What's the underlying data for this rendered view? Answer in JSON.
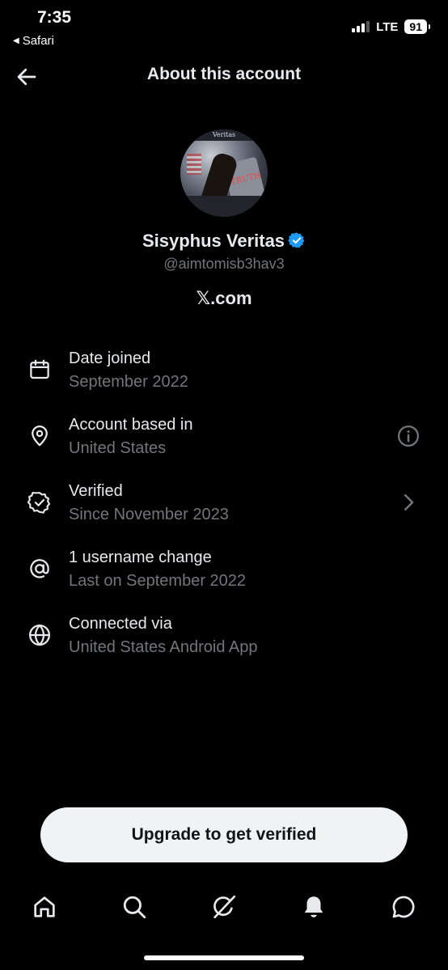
{
  "status_bar": {
    "time": "7:35",
    "back_app": "Safari",
    "network": "LTE",
    "battery": "91"
  },
  "header": {
    "title": "About this account",
    "back_icon": "arrow-left-icon"
  },
  "profile": {
    "display_name": "Sisyphus Veritas",
    "verified_badge": "verified-badge-icon",
    "handle": "@aimtomisb3hav3",
    "site": "𝕏.com",
    "avatar_banner_text": "Veritas",
    "avatar_rock_text": "TRUTH"
  },
  "info": [
    {
      "icon": "calendar-icon",
      "title": "Date joined",
      "subtitle": "September 2022"
    },
    {
      "icon": "location-pin-icon",
      "title": "Account based in",
      "subtitle": "United States",
      "action_icon": "info-icon"
    },
    {
      "icon": "verified-outline-icon",
      "title": "Verified",
      "subtitle": "Since November 2023",
      "action_icon": "chevron-right-icon"
    },
    {
      "icon": "at-sign-icon",
      "title": "1 username change",
      "subtitle": "Last on September 2022"
    },
    {
      "icon": "globe-icon",
      "title": "Connected via",
      "subtitle": "United States Android App"
    }
  ],
  "upgrade": {
    "label": "Upgrade to get verified"
  },
  "bottom_nav": [
    "home-icon",
    "search-icon",
    "grok-icon",
    "notifications-bell-icon",
    "messages-icon"
  ],
  "colors": {
    "background": "#000000",
    "text_primary": "#e7e9ea",
    "text_secondary": "#71767b",
    "verified_blue": "#1d9bf0",
    "button_bg": "#eff3f4"
  }
}
